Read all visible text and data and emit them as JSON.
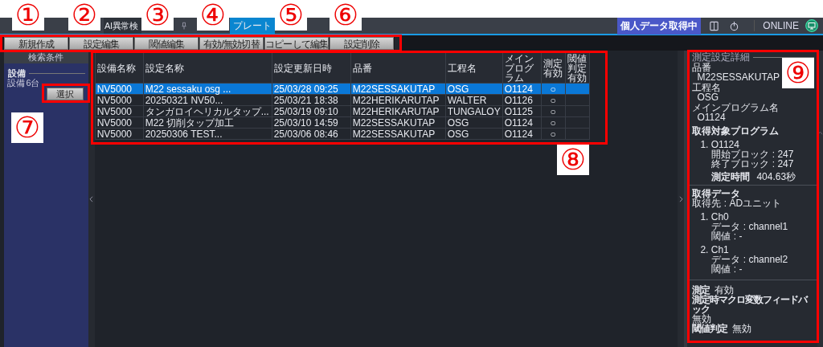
{
  "top_bar": {
    "tabs": [
      {
        "label": "AI異常検",
        "selected": false
      },
      {
        "label": "プレート",
        "selected": true
      }
    ],
    "status_badge": "個人データ取得中",
    "connection": "ONLINE"
  },
  "toolbar": [
    "新規作成",
    "設定編集",
    "閾値編集",
    "有効/無効切替",
    "コピーして編集",
    "設定削除"
  ],
  "search_panel": {
    "title": "検索条件",
    "section": "設備",
    "count": "設備 6台",
    "select_button": "選択"
  },
  "table": {
    "columns": [
      "設備名称",
      "設定名称",
      "設定更新日時",
      "品番",
      "工程名",
      "メインプログラム",
      "測定有効",
      "閾値判定有効"
    ],
    "rows": [
      {
        "selected": true,
        "cells": [
          "NV5000",
          "M22 sessaku osg ...",
          "25/03/28 09:25",
          "M22SESSAKUTAP",
          "OSG",
          "O1124",
          "○",
          ""
        ]
      },
      {
        "selected": false,
        "cells": [
          "NV5000",
          "20250321  NV50...",
          "25/03/21 18:38",
          "M22HERIKARUTAP",
          "WALTER",
          "O1126",
          "○",
          ""
        ]
      },
      {
        "selected": false,
        "cells": [
          "NV5000",
          "タンガロイヘリカルタップ...",
          "25/03/19 09:10",
          "M22HERIKARUTAP",
          "TUNGALOY",
          "O1125",
          "○",
          ""
        ]
      },
      {
        "selected": false,
        "cells": [
          "NV5000",
          "M22  切削タップ加工",
          "25/03/10 14:59",
          "M22SESSAKUTAP",
          "OSG",
          "O1124",
          "○",
          ""
        ]
      },
      {
        "selected": false,
        "cells": [
          "NV5000",
          "20250306  TEST...",
          "25/03/06 08:46",
          "M22SESSAKUTAP",
          "OSG",
          "O1124",
          "○",
          ""
        ]
      }
    ]
  },
  "detail": {
    "title": "測定設定詳細",
    "fields": [
      {
        "label": "品番",
        "value": "M22SESSAKUTAP"
      },
      {
        "label": "工程名",
        "value": "OSG"
      },
      {
        "label": "メインプログラム名",
        "value": "O1124"
      }
    ],
    "program": {
      "heading": "取得対象プログラム",
      "items": [
        {
          "index": "1.",
          "name": "O1124",
          "lines": [
            "開始ブロック : 247",
            "終了ブロック : 247"
          ]
        }
      ],
      "time_label": "測定時間",
      "time_value": "404.63秒"
    },
    "data": {
      "heading": "取得データ",
      "source": "取得先 : ADユニット",
      "items": [
        {
          "index": "1.",
          "name": "Ch0",
          "lines": [
            "データ : channel1",
            "閾値 : -"
          ]
        },
        {
          "index": "2.",
          "name": "Ch1",
          "lines": [
            "データ : channel2",
            "閾値 : -"
          ]
        }
      ]
    },
    "settings": [
      {
        "label": "測定",
        "value": "有効"
      },
      {
        "label": "測定時マクロ変数フィードバック",
        "value": "無効"
      },
      {
        "label": "閾値判定",
        "value": "無効"
      }
    ]
  },
  "annotations": {
    "markers": [
      "①",
      "②",
      "③",
      "④",
      "⑤",
      "⑥",
      "⑦",
      "⑧",
      "⑨"
    ]
  }
}
